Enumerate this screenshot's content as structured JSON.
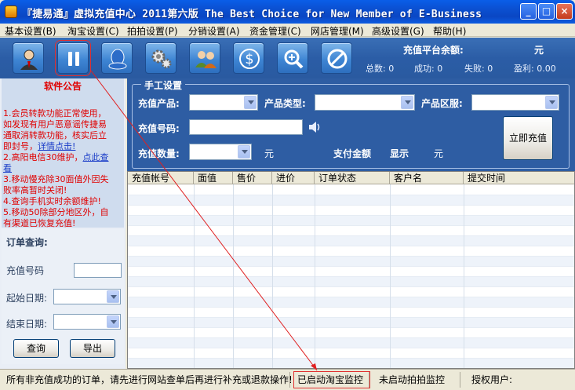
{
  "window": {
    "title": "『捷易通』虚拟充值中心   2011第六版   The Best Choice for New Member of E-Business",
    "buttons": [
      "_",
      "□",
      "×"
    ]
  },
  "menu": [
    "基本设置(B)",
    "淘宝设置(C)",
    "拍拍设置(P)",
    "分销设置(A)",
    "资金管理(C)",
    "网店管理(M)",
    "高级设置(G)",
    "帮助(H)"
  ],
  "toolbar": {
    "icons": [
      "user-icon",
      "pause-icon",
      "qq-icon",
      "gears-icon",
      "users-icon",
      "money-icon",
      "zoom-icon",
      "stop-icon"
    ],
    "balance_label": "充值平台余额:",
    "balance_unit": "元",
    "stats": {
      "total": "总数: 0",
      "success": "成功: 0",
      "fail": "失败: 0",
      "profit": "盈利: 0.00"
    }
  },
  "notice": {
    "title": "软件公告",
    "lines": [
      "1.会员转款功能正常使用，",
      "如发现有用户恶意谣传捷易",
      "通取消转款功能，核实后立",
      "即封号，",
      "2.高阳电信30维护，",
      "3.移动慢充除30面值外因失",
      "败率高暂时关闭!",
      "4.查询手机实时余额维护!",
      "5.移动50除部分地区外，自",
      "有渠道已恢复充值!"
    ],
    "link1": "详情点击!",
    "link2": "点此查",
    "link2b": "看"
  },
  "order_query": {
    "title": "订单查询:",
    "phone_label": "充值号码",
    "start_label": "起始日期:",
    "end_label": "结束日期:",
    "query_btn": "查询",
    "export_btn": "导出"
  },
  "manual": {
    "legend": "手工设置",
    "product_label": "充值产品:",
    "type_label": "产品类型:",
    "region_label": "产品区服:",
    "number_label": "充值号码:",
    "qty_label": "充值数量:",
    "qty_unit": "元",
    "pay_label": "支付金额",
    "pay_value": "显示",
    "pay_unit": "元",
    "charge_btn": "立即充值"
  },
  "grid": {
    "columns": [
      "充值帐号",
      "面值",
      "售价",
      "进价",
      "订单状态",
      "客户名",
      "提交时间"
    ]
  },
  "statusbar": {
    "message": "所有非充值成功的订单，请先进行网站查单后再进行补充或退款操作!",
    "taobao": "已启动淘宝监控",
    "paipai": "未启动拍拍监控",
    "user": "授权用户:"
  }
}
